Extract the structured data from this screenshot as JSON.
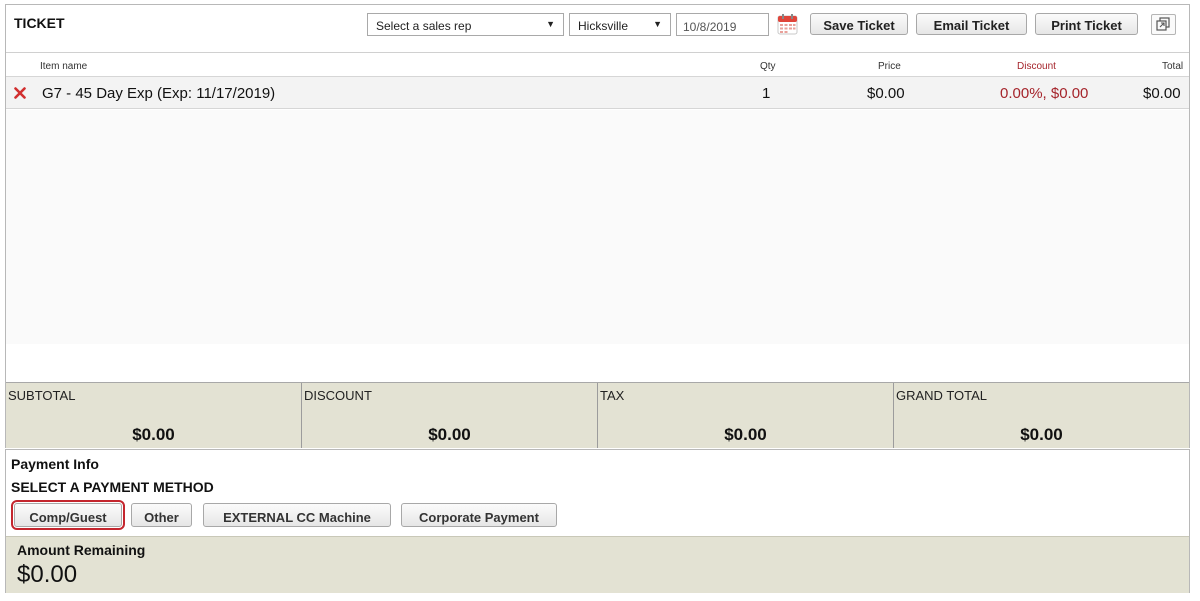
{
  "ticket": {
    "title": "TICKET",
    "sales_rep": {
      "value": "Select a sales rep"
    },
    "location": {
      "value": "Hicksville"
    },
    "date": {
      "value": "10/8/2019"
    },
    "buttons": {
      "save": "Save Ticket",
      "email": "Email Ticket",
      "print": "Print Ticket"
    },
    "icons": {
      "calendar": "calendar-icon",
      "expand": "popout-icon",
      "remove": "close-icon"
    },
    "columns": {
      "item_name": "Item name",
      "qty": "Qty",
      "price": "Price",
      "discount": "Discount",
      "total": "Total"
    },
    "items": [
      {
        "name": "G7 - 45 Day Exp (Exp: 11/17/2019)",
        "qty": "1",
        "price": "$0.00",
        "discount": "0.00%, $0.00",
        "total": "$0.00"
      }
    ],
    "totals": {
      "subtotal_label": "SUBTOTAL",
      "subtotal_value": "$0.00",
      "discount_label": "DISCOUNT",
      "discount_value": "$0.00",
      "tax_label": "TAX",
      "tax_value": "$0.00",
      "grand_total_label": "GRAND TOTAL",
      "grand_total_value": "$0.00"
    }
  },
  "payment": {
    "info_label": "Payment Info",
    "select_label": "SELECT A PAYMENT METHOD",
    "methods": [
      "Comp/Guest",
      "Other",
      "EXTERNAL CC Machine",
      "Corporate Payment"
    ],
    "selected_method": "Comp/Guest",
    "amount_remaining_label": "Amount Remaining",
    "amount_remaining_value": "$0.00"
  },
  "colors": {
    "discount_red": "#a5242b",
    "totals_bg": "#e3e2d3",
    "selected_outline": "#c4262e",
    "remove_icon": "#d12f2f"
  }
}
